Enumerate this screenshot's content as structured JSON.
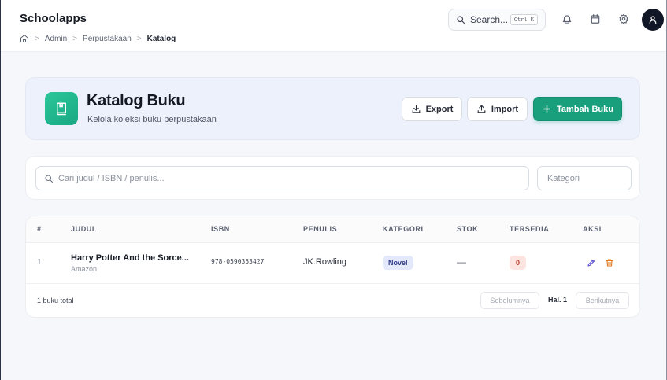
{
  "app": {
    "title": "Schoolapps"
  },
  "breadcrumb": [
    "Admin",
    "Perpustakaan",
    "Katalog"
  ],
  "header": {
    "search_label": "Search...",
    "search_shortcut": "Ctrl K",
    "icons": [
      "bell-icon",
      "calendar-icon",
      "gear-icon",
      "user-icon"
    ]
  },
  "hero": {
    "icon": "book-icon",
    "title": "Katalog Buku",
    "subtitle": "Kelola koleksi buku perpustakaan",
    "export_label": "Export",
    "import_label": "Import",
    "add_label": "Tambah Buku"
  },
  "filters": {
    "search_placeholder": "Cari judul / ISBN / penulis...",
    "category_placeholder": "Kategori"
  },
  "table": {
    "columns": [
      "#",
      "JUDUL",
      "ISBN",
      "PENULIS",
      "KATEGORI",
      "STOK",
      "TERSEDIA",
      "AKSI"
    ],
    "rows": [
      {
        "no": "1",
        "title": "Harry Potter And the Sorce...",
        "publisher": "Amazon",
        "isbn": "978-0590353427",
        "author": "JK.Rowling",
        "category": "Novel",
        "stock": "—",
        "available": "0"
      }
    ]
  },
  "pagination": {
    "total": "1 buku total",
    "prev": "Sebelumnya",
    "page": "Hal. 1",
    "next": "Berikutnya"
  },
  "colors": {
    "accent": "#1a9f7d",
    "hero_bg": "#edf1fb",
    "category_badge": "#e3e8fb",
    "available_badge": "#fde4e1",
    "edit_icon": "#5b4fd0",
    "delete_icon": "#e0761c"
  }
}
